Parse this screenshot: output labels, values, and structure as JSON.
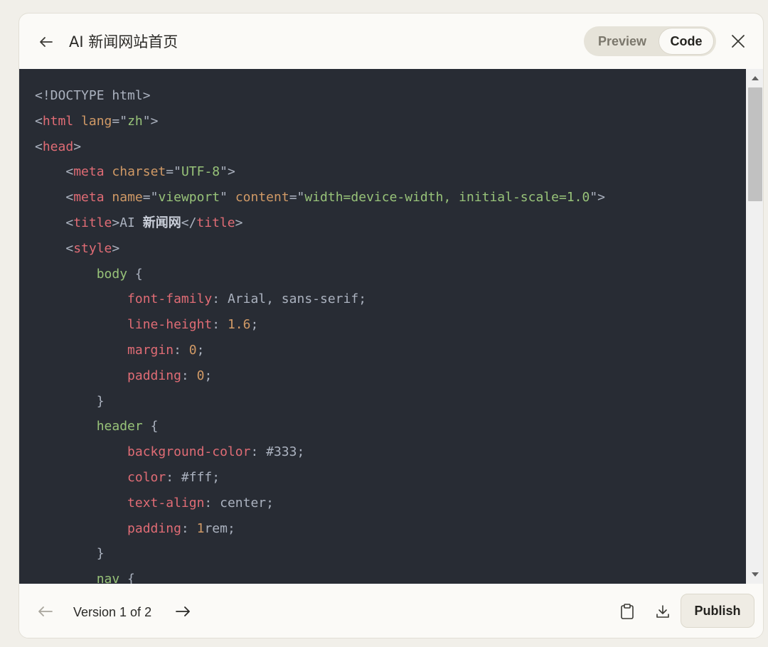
{
  "header": {
    "title": "AI 新闻网站首页",
    "preview_label": "Preview",
    "code_label": "Code",
    "active_tab": "Code"
  },
  "code": {
    "language": "html",
    "lines": [
      [
        [
          "punc",
          "<!DOCTYPE html>"
        ]
      ],
      [
        [
          "punc",
          "<"
        ],
        [
          "tag",
          "html"
        ],
        [
          "punc",
          " "
        ],
        [
          "attr",
          "lang"
        ],
        [
          "punc",
          "=\""
        ],
        [
          "str",
          "zh"
        ],
        [
          "punc",
          "\">"
        ]
      ],
      [
        [
          "punc",
          "<"
        ],
        [
          "tag",
          "head"
        ],
        [
          "punc",
          ">"
        ]
      ],
      [
        [
          "punc",
          "    <"
        ],
        [
          "tag",
          "meta"
        ],
        [
          "punc",
          " "
        ],
        [
          "attr",
          "charset"
        ],
        [
          "punc",
          "=\""
        ],
        [
          "str",
          "UTF-8"
        ],
        [
          "punc",
          "\">"
        ]
      ],
      [
        [
          "punc",
          "    <"
        ],
        [
          "tag",
          "meta"
        ],
        [
          "punc",
          " "
        ],
        [
          "attr",
          "name"
        ],
        [
          "punc",
          "=\""
        ],
        [
          "str",
          "viewport"
        ],
        [
          "punc",
          "\" "
        ],
        [
          "attr",
          "content"
        ],
        [
          "punc",
          "=\""
        ],
        [
          "str",
          "width=device-width, initial-scale=1.0"
        ],
        [
          "punc",
          "\">"
        ]
      ],
      [
        [
          "punc",
          "    <"
        ],
        [
          "tag",
          "title"
        ],
        [
          "punc",
          ">AI "
        ],
        [
          "bold",
          "新闻网"
        ],
        [
          "punc",
          "</"
        ],
        [
          "tag",
          "title"
        ],
        [
          "punc",
          ">"
        ]
      ],
      [
        [
          "punc",
          "    <"
        ],
        [
          "tag",
          "style"
        ],
        [
          "punc",
          ">"
        ]
      ],
      [
        [
          "punc",
          "        "
        ],
        [
          "sel",
          "body"
        ],
        [
          "punc",
          " {"
        ]
      ],
      [
        [
          "punc",
          "            "
        ],
        [
          "prop",
          "font-family"
        ],
        [
          "punc",
          ": "
        ],
        [
          "val",
          "Arial, sans-serif"
        ],
        [
          "punc",
          ";"
        ]
      ],
      [
        [
          "punc",
          "            "
        ],
        [
          "prop",
          "line-height"
        ],
        [
          "punc",
          ": "
        ],
        [
          "num",
          "1.6"
        ],
        [
          "punc",
          ";"
        ]
      ],
      [
        [
          "punc",
          "            "
        ],
        [
          "prop",
          "margin"
        ],
        [
          "punc",
          ": "
        ],
        [
          "num",
          "0"
        ],
        [
          "punc",
          ";"
        ]
      ],
      [
        [
          "punc",
          "            "
        ],
        [
          "prop",
          "padding"
        ],
        [
          "punc",
          ": "
        ],
        [
          "num",
          "0"
        ],
        [
          "punc",
          ";"
        ]
      ],
      [
        [
          "punc",
          "        }"
        ]
      ],
      [
        [
          "punc",
          "        "
        ],
        [
          "sel",
          "header"
        ],
        [
          "punc",
          " {"
        ]
      ],
      [
        [
          "punc",
          "            "
        ],
        [
          "prop",
          "background-color"
        ],
        [
          "punc",
          ": "
        ],
        [
          "val",
          "#333"
        ],
        [
          "punc",
          ";"
        ]
      ],
      [
        [
          "punc",
          "            "
        ],
        [
          "prop",
          "color"
        ],
        [
          "punc",
          ": "
        ],
        [
          "val",
          "#fff"
        ],
        [
          "punc",
          ";"
        ]
      ],
      [
        [
          "punc",
          "            "
        ],
        [
          "prop",
          "text-align"
        ],
        [
          "punc",
          ": "
        ],
        [
          "val",
          "center"
        ],
        [
          "punc",
          ";"
        ]
      ],
      [
        [
          "punc",
          "            "
        ],
        [
          "prop",
          "padding"
        ],
        [
          "punc",
          ": "
        ],
        [
          "num",
          "1"
        ],
        [
          "val",
          "rem"
        ],
        [
          "punc",
          ";"
        ]
      ],
      [
        [
          "punc",
          "        }"
        ]
      ],
      [
        [
          "punc",
          "        "
        ],
        [
          "sel",
          "nav"
        ],
        [
          "punc",
          " {"
        ]
      ]
    ]
  },
  "footer": {
    "version_label": "Version 1 of 2",
    "publish_label": "Publish"
  },
  "icons": {
    "back": "arrow-left-icon",
    "close": "close-icon",
    "prev": "arrow-left-icon",
    "next": "arrow-right-icon",
    "copy": "clipboard-icon",
    "download": "download-icon"
  },
  "colors": {
    "code_bg": "#282c34",
    "tag": "#e06c75",
    "attr": "#d19a66",
    "string": "#98c379",
    "text": "#abb2bf"
  }
}
